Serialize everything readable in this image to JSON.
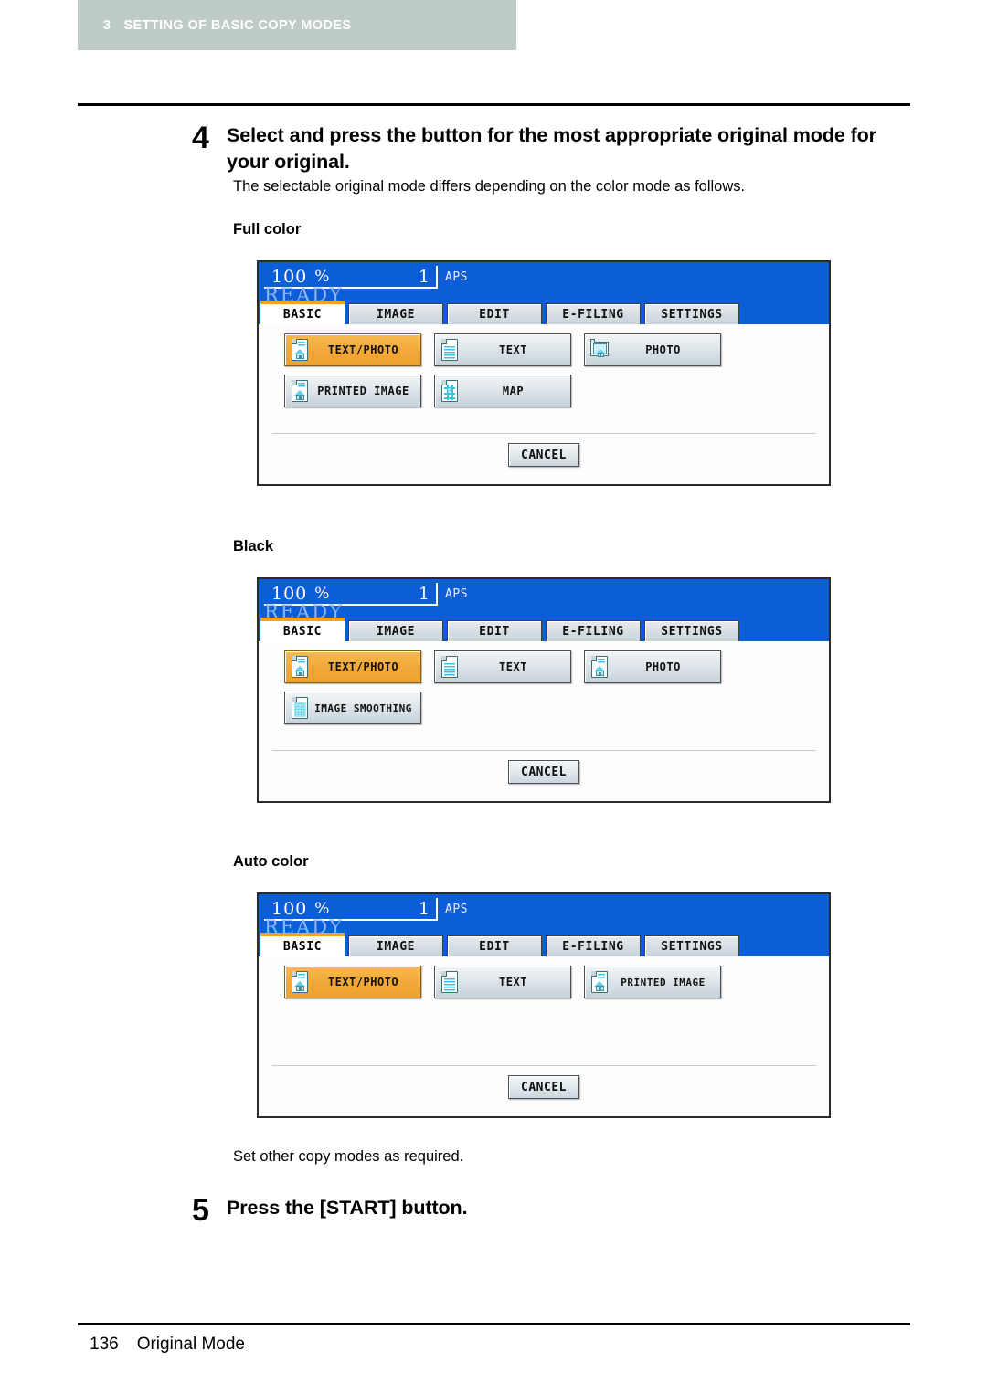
{
  "header": {
    "chapter_number": "3",
    "chapter_title": "SETTING OF BASIC COPY MODES",
    "bar_color": "#bfcbc8"
  },
  "steps": [
    {
      "number": "4",
      "title": "Select and press the button for the most appropriate original mode for your original.",
      "description": "The selectable original mode differs depending on the color mode as follows."
    },
    {
      "number": "5",
      "title": "Press the [START] button."
    }
  ],
  "note": "Set other copy modes as required.",
  "mode_labels": {
    "full_color": "Full color",
    "black": "Black",
    "auto_color": "Auto color"
  },
  "panel_common": {
    "ratio_value": "100",
    "ratio_percent": "%",
    "copy_count": "1",
    "paper_mode": "APS",
    "status": "READY",
    "tabs": [
      {
        "label": "BASIC",
        "active": true
      },
      {
        "label": "IMAGE",
        "active": false
      },
      {
        "label": "EDIT",
        "active": false
      },
      {
        "label": "E-FILING",
        "active": false
      },
      {
        "label": "SETTINGS",
        "active": false
      }
    ],
    "cancel_label": "CANCEL",
    "screen_bg": "#0b5ed7",
    "active_tab_accent": "#f2a41c",
    "selected_button_color": "#f2a93a"
  },
  "panels": {
    "full_color": {
      "rows": [
        [
          {
            "label": "TEXT/PHOTO",
            "icon": "doc-house-icon",
            "selected": true
          },
          {
            "label": "TEXT",
            "icon": "doc-lines-icon",
            "selected": false
          },
          {
            "label": "PHOTO",
            "icon": "photo-frame-icon",
            "selected": false
          }
        ],
        [
          {
            "label": "PRINTED IMAGE",
            "icon": "doc-house-icon",
            "selected": false
          },
          {
            "label": "MAP",
            "icon": "doc-map-icon",
            "selected": false
          },
          {
            "label": "",
            "icon": "",
            "selected": false,
            "empty": true
          }
        ]
      ]
    },
    "black": {
      "rows": [
        [
          {
            "label": "TEXT/PHOTO",
            "icon": "doc-house-icon",
            "selected": true
          },
          {
            "label": "TEXT",
            "icon": "doc-lines-icon",
            "selected": false
          },
          {
            "label": "PHOTO",
            "icon": "doc-house-icon",
            "selected": false
          }
        ],
        [
          {
            "label": "IMAGE SMOOTHING",
            "icon": "doc-dots-icon",
            "selected": false
          },
          {
            "label": "",
            "icon": "",
            "selected": false,
            "empty": true
          },
          {
            "label": "",
            "icon": "",
            "selected": false,
            "empty": true
          }
        ]
      ]
    },
    "auto_color": {
      "rows": [
        [
          {
            "label": "TEXT/PHOTO",
            "icon": "doc-house-icon",
            "selected": true
          },
          {
            "label": "TEXT",
            "icon": "doc-lines-icon",
            "selected": false
          },
          {
            "label": "PRINTED IMAGE",
            "icon": "doc-house-icon",
            "selected": false
          }
        ],
        [
          {
            "label": "",
            "icon": "",
            "selected": false,
            "empty": true
          },
          {
            "label": "",
            "icon": "",
            "selected": false,
            "empty": true
          },
          {
            "label": "",
            "icon": "",
            "selected": false,
            "empty": true
          }
        ]
      ]
    }
  },
  "footer": {
    "page_number": "136",
    "section_title": "Original Mode"
  }
}
